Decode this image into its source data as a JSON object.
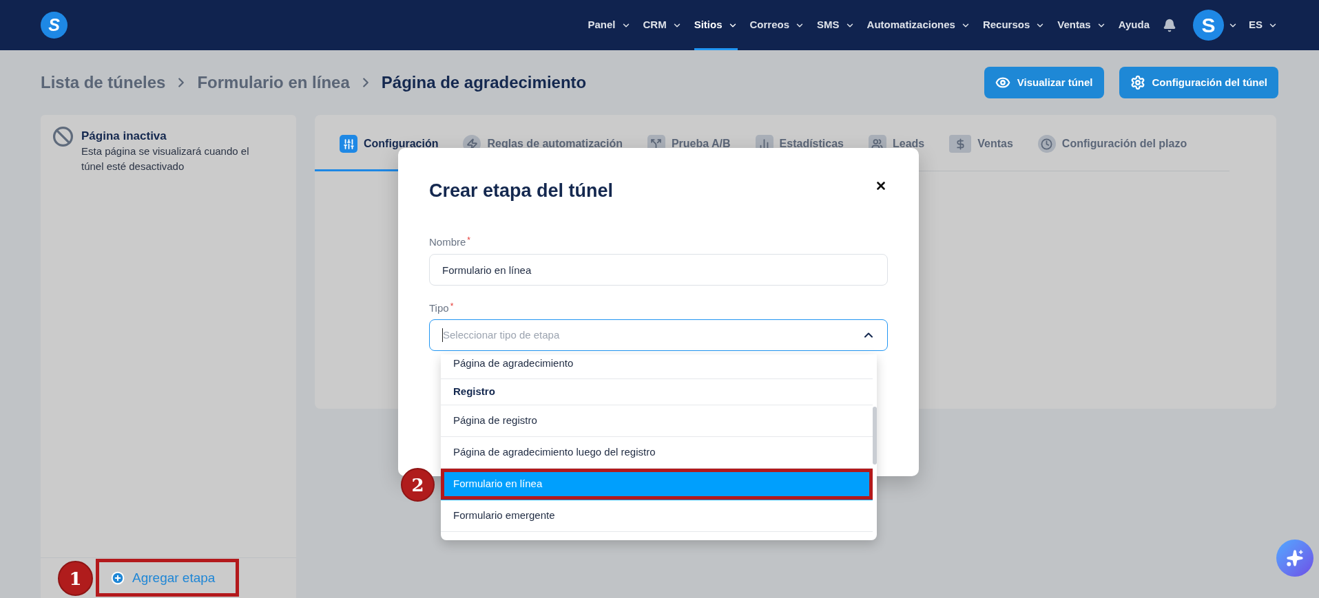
{
  "nav": {
    "logo": "S",
    "items": [
      {
        "label": "Panel",
        "dropdown": true,
        "selected": false
      },
      {
        "label": "CRM",
        "dropdown": true,
        "selected": false
      },
      {
        "label": "Sitios",
        "dropdown": true,
        "selected": true
      },
      {
        "label": "Correos",
        "dropdown": true,
        "selected": false
      },
      {
        "label": "SMS",
        "dropdown": true,
        "selected": false
      },
      {
        "label": "Automatizaciones",
        "dropdown": true,
        "selected": false
      },
      {
        "label": "Recursos",
        "dropdown": true,
        "selected": false
      },
      {
        "label": "Ventas",
        "dropdown": true,
        "selected": false
      },
      {
        "label": "Ayuda",
        "dropdown": false,
        "selected": false
      }
    ],
    "avatar": {
      "initial": "S",
      "dropdown": true
    },
    "language": {
      "label": "ES",
      "dropdown": true
    }
  },
  "breadcrumb": [
    {
      "label": "Lista de túneles",
      "current": false
    },
    {
      "label": "Formulario en línea",
      "current": false
    },
    {
      "label": "Página de agradecimiento",
      "current": true
    }
  ],
  "header_buttons": [
    "Visualizar túnel",
    "Configuración del túnel"
  ],
  "sidebar": {
    "status": {
      "title": "Página inactiva",
      "description": "Esta página se visualizará cuando el túnel esté desactivado"
    },
    "add_button": {
      "label": "Agregar etapa",
      "step_marker": "1"
    }
  },
  "tabs": [
    {
      "label": "Configuración",
      "selected": true
    },
    {
      "label": "Reglas de automatización",
      "selected": false
    },
    {
      "label": "Prueba A/B",
      "selected": false
    },
    {
      "label": "Estadísticas",
      "selected": false
    },
    {
      "label": "Leads",
      "selected": false
    },
    {
      "label": "Ventas",
      "selected": false
    },
    {
      "label": "Configuración del plazo",
      "selected": false
    }
  ],
  "modal": {
    "title": "Crear etapa del túnel",
    "fields": [
      {
        "kind": "text",
        "label": "Nombre",
        "required_mark": "*",
        "value": "Formulario en línea"
      },
      {
        "kind": "select",
        "label": "Tipo",
        "required_mark": "*",
        "placeholder": "Seleccionar tipo de etapa",
        "expanded": true,
        "options": [
          {
            "kind": "option",
            "label": "Página de agradecimiento",
            "selected": false
          },
          {
            "kind": "group",
            "label": "Registro"
          },
          {
            "kind": "option",
            "label": "Página de registro",
            "selected": false
          },
          {
            "kind": "option",
            "label": "Página de agradecimiento luego del registro",
            "selected": false
          },
          {
            "kind": "option",
            "label": "Formulario en línea",
            "selected": true,
            "step_marker": "2"
          },
          {
            "kind": "option",
            "label": "Formulario emergente",
            "selected": false
          }
        ]
      }
    ]
  }
}
